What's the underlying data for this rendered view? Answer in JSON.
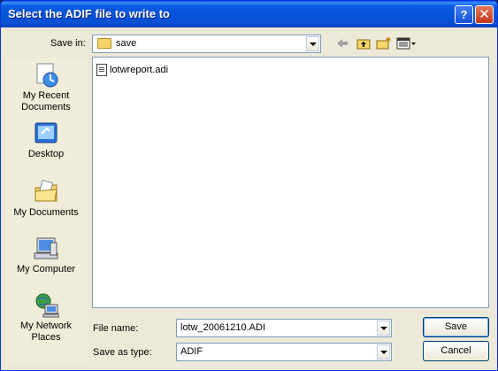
{
  "window": {
    "title": "Select the ADIF file to write to",
    "help_glyph": "?",
    "close_glyph": "✕"
  },
  "toolbar": {
    "save_in_label": "Save in:",
    "save_in_value": "save",
    "back_icon": "back-arrow-icon",
    "up_icon": "up-folder-icon",
    "new_folder_icon": "new-folder-icon",
    "view_icon": "view-menu-icon"
  },
  "places": [
    {
      "label": "My Recent Documents",
      "icon": "recent-documents-icon"
    },
    {
      "label": "Desktop",
      "icon": "desktop-icon"
    },
    {
      "label": "My Documents",
      "icon": "my-documents-icon"
    },
    {
      "label": "My Computer",
      "icon": "my-computer-icon"
    },
    {
      "label": "My Network Places",
      "icon": "network-places-icon"
    }
  ],
  "files": [
    {
      "name": "lotwreport.adi",
      "icon": "adi-file-icon"
    }
  ],
  "form": {
    "file_name_label": "File name:",
    "file_name_value": "lotw_20061210.ADI",
    "save_as_type_label": "Save as type:",
    "save_as_type_value": "ADIF"
  },
  "buttons": {
    "save": "Save",
    "cancel": "Cancel"
  },
  "colors": {
    "titlebar": "#0553d8",
    "window_bg": "#ece9d8",
    "field_border": "#7f9db9"
  }
}
